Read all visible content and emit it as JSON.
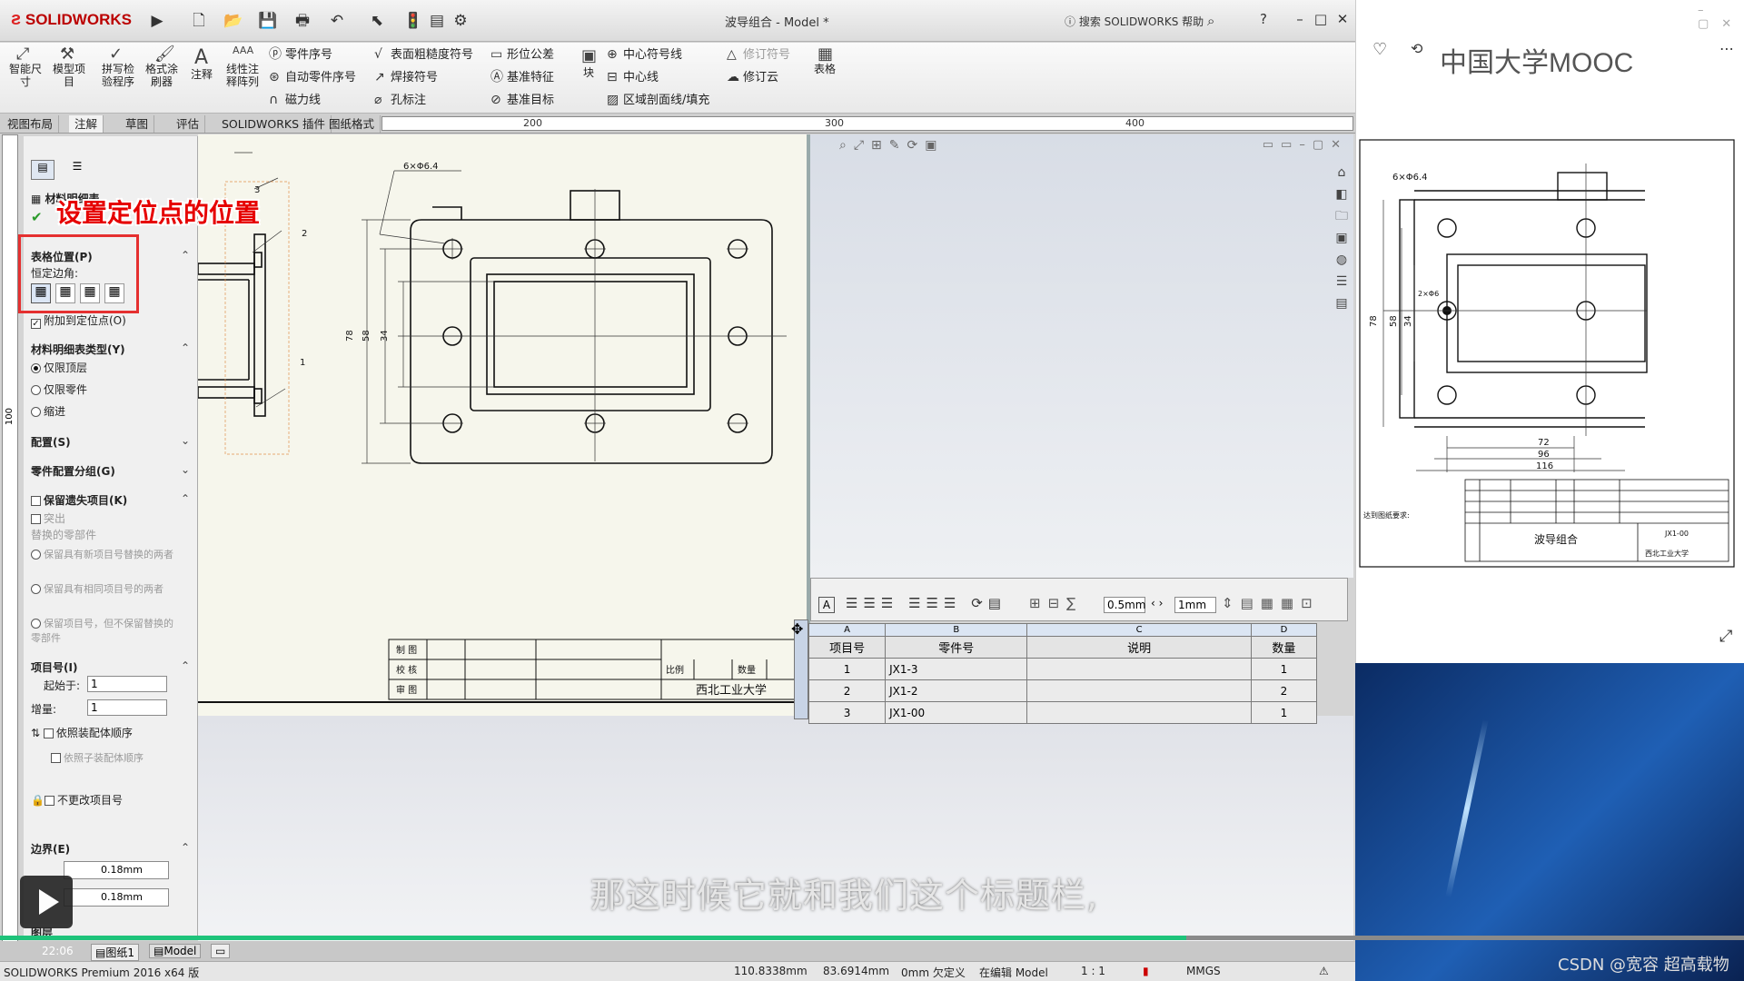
{
  "app": {
    "brand": "SOLIDWORKS",
    "doc_title": "波导组合 - Model *",
    "search_placeholder": "搜索 SOLIDWORKS 帮助",
    "help_glyph": "?"
  },
  "ribbon": {
    "smart_dim": "智能尺寸",
    "model_items": "模型项目",
    "spell_check": "拼写检验程序",
    "format_painter": "格式涂刷器",
    "note": "注释",
    "linear_note": "线性注释阵列",
    "balloon": "零件序号",
    "auto_balloon": "自动零件序号",
    "magnetic_line": "磁力线",
    "surface_finish": "表面粗糙度符号",
    "weld_symbol": "焊接符号",
    "hole_callout": "孔标注",
    "gtol": "形位公差",
    "datum_feature": "基准特征",
    "datum_target": "基准目标",
    "block": "块",
    "center_mark": "中心符号线",
    "centerline": "中心线",
    "area_hatch": "区域剖面线/填充",
    "revision_symbol": "修订符号",
    "revision_cloud": "修订云",
    "tables": "表格"
  },
  "tabs": [
    "视图布局",
    "注解",
    "草图",
    "评估",
    "SOLIDWORKS 插件",
    "图纸格式"
  ],
  "active_tab": 1,
  "ruler": [
    "200",
    "300",
    "400"
  ],
  "vruler": "100",
  "panel": {
    "title": "材料明细表",
    "table_position": "表格位置(P)",
    "anchor_corner": "恒定边角:",
    "attach_anchor": "附加到定位点(O)",
    "bom_type": "材料明细表类型(Y)",
    "top_level": "仅限顶层",
    "parts_only": "仅限零件",
    "indented": "缩进",
    "configurations": "配置(S)",
    "part_config_group": "零件配置分组(G)",
    "keep_missing": "保留遗失项目(K)",
    "strikeout": "突出",
    "replaced_parts": "替换的零部件",
    "opt1": "保留具有新项目号替换的两者",
    "opt2": "保留具有相同项目号的两者",
    "opt3": "保留项目号，但不保留替换的零部件",
    "item_numbers": "项目号(I)",
    "start_at_label": "起始于:",
    "start_at": "1",
    "increment_label": "增量:",
    "increment": "1",
    "follow_assembly": "依照装配体顺序",
    "follow_subassembly": "依照子装配体顺序",
    "do_not_change": "不更改项目号",
    "border": "边界(E)",
    "border_w1": "0.18mm",
    "border_w2": "0.18mm",
    "layer": "图层"
  },
  "annotation": "设置定位点的位置",
  "drawing": {
    "dim_holes": "6×Φ6.4",
    "balloon3": "3",
    "balloon2": "2",
    "balloon1": "1",
    "d78": "78",
    "d58": "58",
    "d34": "34",
    "title_rows": [
      "制 图",
      "校 核",
      "审 图"
    ],
    "scale_label": "比例",
    "qty_label": "数量",
    "university": "西北工业大学"
  },
  "table_toolbar": {
    "line_width": "0.5mm",
    "spacing": "1mm"
  },
  "bom": {
    "letters": [
      "A",
      "B",
      "C",
      "D"
    ],
    "headers": [
      "项目号",
      "零件号",
      "说明",
      "数量"
    ],
    "rows": [
      {
        "item": "1",
        "part": "JX1-3",
        "desc": "",
        "qty": "1"
      },
      {
        "item": "2",
        "part": "JX1-2",
        "desc": "",
        "qty": "2"
      },
      {
        "item": "3",
        "part": "JX1-00",
        "desc": "",
        "qty": "1"
      }
    ]
  },
  "sheet_tabs": [
    "图纸1",
    "Model"
  ],
  "status": {
    "product": "SOLIDWORKS Premium 2016 x64 版",
    "x": "110.8338mm",
    "y": "83.6914mm",
    "z": "0mm 欠定义",
    "mode": "在编辑 Model",
    "scale": "1 : 1",
    "units": "MMGS"
  },
  "video": {
    "time": "22:06",
    "progress": 0.68
  },
  "subtitle": "那这时候它就和我们这个标题栏,",
  "mooc": {
    "brand": "中国大学MOOC",
    "dim_holes": "6×Φ6.4",
    "dim_small": "2×Φ6",
    "d78": "78",
    "d58": "58",
    "d34": "34",
    "d72": "72",
    "d96": "96",
    "d116": "116",
    "notes_label": "达到图纸要求:",
    "title_name": "波导组合",
    "title_code": "JX1-00",
    "university": "西北工业大学"
  },
  "watermark": "CSDN @宽容 超高载物"
}
